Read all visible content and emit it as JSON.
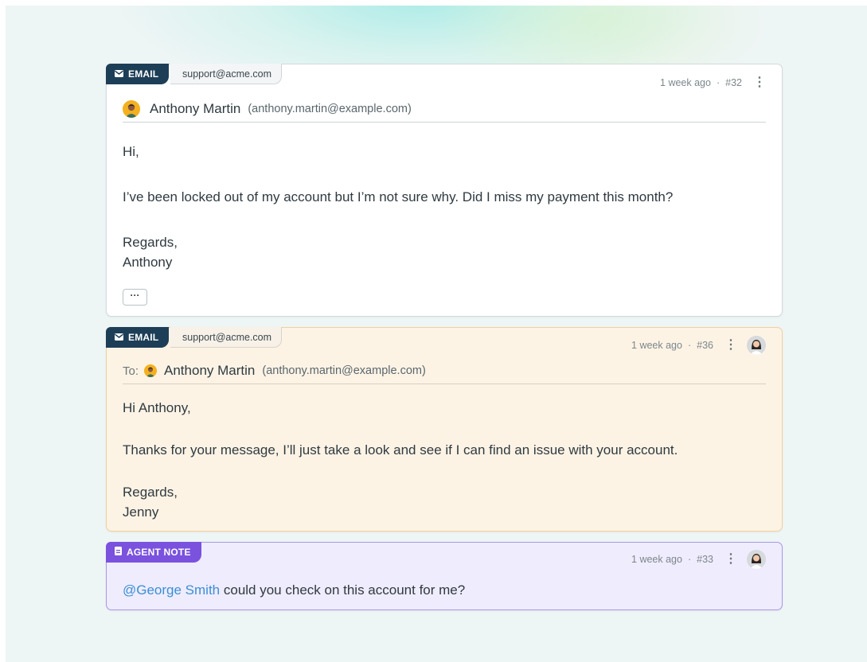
{
  "messages": [
    {
      "type_label": "EMAIL",
      "mailbox": "support@acme.com",
      "time": "1 week ago",
      "separator": "·",
      "id": "#32",
      "sender_name": "Anthony Martin",
      "sender_email": "(anthony.martin@example.com)",
      "body": [
        "Hi,",
        "I’ve been locked out of my account but I’m not sure why. Did I miss my payment this month?",
        "Regards,",
        "Anthony"
      ],
      "expand_label": "···"
    },
    {
      "type_label": "EMAIL",
      "mailbox": "support@acme.com",
      "time": "1 week ago",
      "separator": "·",
      "id": "#36",
      "to_label": "To:",
      "recipient_name": "Anthony Martin",
      "recipient_email": "(anthony.martin@example.com)",
      "body": [
        "Hi Anthony,",
        "Thanks for your message, I’ll just take a look and see if I can find an issue with your account.",
        "Regards,",
        "Jenny"
      ]
    },
    {
      "type_label": "AGENT NOTE",
      "time": "1 week ago",
      "separator": "·",
      "id": "#33",
      "mention": "@George Smith",
      "note_text": " could you check on this account for me?"
    }
  ],
  "icons": {
    "email": "envelope-icon",
    "note": "note-icon",
    "menu": "kebab-menu-icon"
  },
  "colors": {
    "email_tag": "#1d3e57",
    "note_tag": "#7a52de",
    "reply_bg": "#fdf3e5",
    "note_bg": "#efecfd",
    "mention": "#3a8fd6"
  }
}
